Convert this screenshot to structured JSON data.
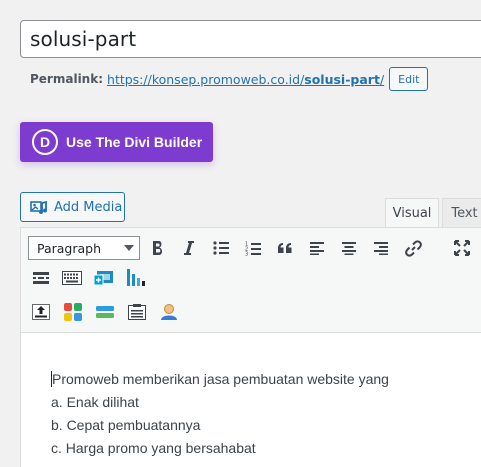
{
  "title": {
    "value": "solusi-part"
  },
  "permalink": {
    "label": "Permalink:",
    "url_base": "https://konsep.promoweb.co.id/",
    "slug": "solusi-part",
    "url_tail": "/",
    "edit_label": "Edit"
  },
  "divi": {
    "logo": "D",
    "label": "Use The Divi Builder",
    "color": "#7e3bd0"
  },
  "media": {
    "add_label": "Add Media"
  },
  "tabs": {
    "visual": "Visual",
    "text": "Text"
  },
  "toolbar": {
    "format_value": "Paragraph",
    "row1_icons": [
      "bold-icon",
      "italic-icon",
      "bulleted-list-icon",
      "numbered-list-icon",
      "blockquote-icon",
      "align-left-icon",
      "align-center-icon",
      "align-right-icon",
      "insert-link-icon",
      "fullscreen-icon"
    ],
    "row2_icons": [
      "insert-more-icon",
      "keyboard-icon",
      "plugin-screen-icon",
      "chart-bars-icon"
    ],
    "row3_icons": [
      "upload-icon",
      "color-grid-icon",
      "layers-icon",
      "clipboard-icon",
      "user-icon"
    ]
  },
  "content": {
    "lines": [
      "Promoweb memberikan jasa pembuatan website yang",
      "a. Enak dilihat",
      "b. Cepat pembuatannya",
      "c. Harga promo yang bersahabat"
    ]
  }
}
